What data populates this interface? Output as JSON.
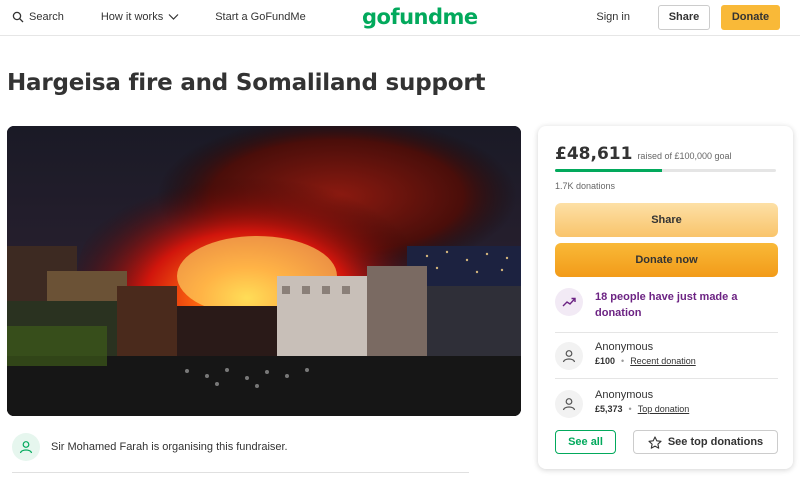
{
  "header": {
    "search_label": "Search",
    "how_label": "How it works",
    "start_label": "Start a GoFundMe",
    "logo_text": "gofundme",
    "signin_label": "Sign in",
    "share_label": "Share",
    "donate_label": "Donate"
  },
  "page": {
    "title": "Hargeisa fire and Somaliland support"
  },
  "organiser": {
    "text": "Sir Mohamed Farah is organising this fundraiser."
  },
  "card": {
    "amount": "£48,611",
    "goal_text": "raised of £100,000 goal",
    "progress_fraction": 0.486,
    "count_text": "1.7K donations",
    "share_label": "Share",
    "donate_label": "Donate now",
    "trend_text": "18 people have just made a donation",
    "donors": [
      {
        "name": "Anonymous",
        "amount": "£100",
        "tag": "Recent donation"
      },
      {
        "name": "Anonymous",
        "amount": "£5,373",
        "tag": "Top donation"
      }
    ],
    "see_all_label": "See all",
    "see_top_label": "See top donations"
  },
  "colors": {
    "brand_green": "#02a95c",
    "donate_orange": "#f9b938",
    "trend_purple": "#6c2383"
  },
  "icons": {
    "search": "search-icon",
    "how_chevron": "chevron-down-icon",
    "trend": "trending-up-icon",
    "user": "user-icon",
    "star": "star-icon"
  }
}
